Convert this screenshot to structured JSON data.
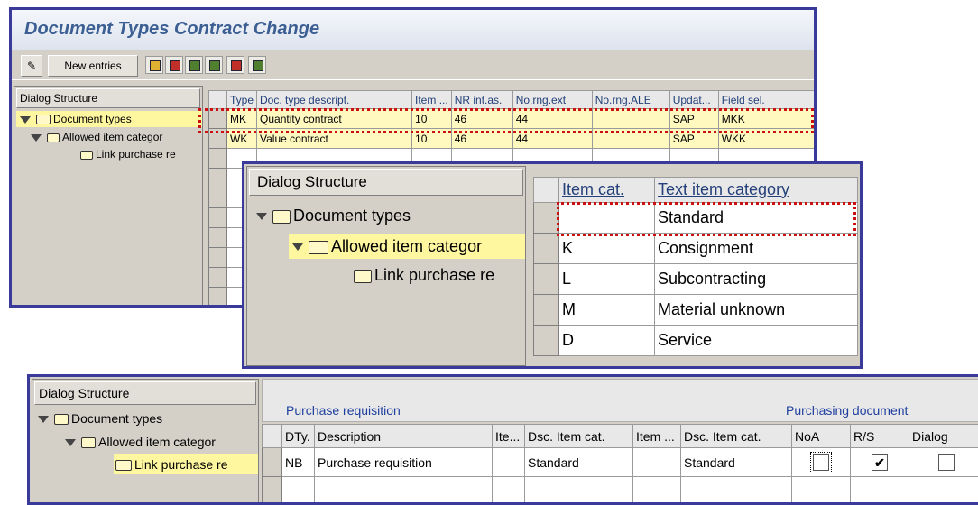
{
  "window1": {
    "title": "Document Types Contract Change",
    "toolbar": {
      "new_entries_label": "New entries"
    },
    "dialog": {
      "header": "Dialog Structure",
      "items": [
        "Document types",
        "Allowed item categor",
        "Link purchase re"
      ]
    },
    "table": {
      "columns": [
        "Type",
        "Doc. type descript.",
        "Item ...",
        "NR int.as.",
        "No.rng.ext",
        "No.rng.ALE",
        "Updat...",
        "Field sel."
      ],
      "rows": [
        [
          "MK",
          "Quantity contract",
          "10",
          "46",
          "44",
          "",
          "SAP",
          "MKK"
        ],
        [
          "WK",
          "Value contract",
          "10",
          "46",
          "44",
          "",
          "SAP",
          "WKK"
        ]
      ]
    }
  },
  "window2": {
    "dialog": {
      "header": "Dialog Structure",
      "items": [
        "Document types",
        "Allowed item categor",
        "Link purchase re"
      ]
    },
    "table": {
      "columns": [
        "Item cat.",
        "Text item category"
      ],
      "rows": [
        [
          "",
          "Standard"
        ],
        [
          "K",
          "Consignment"
        ],
        [
          "L",
          "Subcontracting"
        ],
        [
          "M",
          "Material unknown"
        ],
        [
          "D",
          "Service"
        ]
      ]
    }
  },
  "window3": {
    "dialog": {
      "header": "Dialog Structure",
      "items": [
        "Document types",
        "Allowed item categor",
        "Link purchase re"
      ]
    },
    "group_left": "Purchase requisition",
    "group_right": "Purchasing document",
    "table": {
      "columns": [
        "DTy.",
        "Description",
        "Ite...",
        "Dsc. Item cat.",
        "Item ...",
        "Dsc. Item cat.",
        "NoA",
        "R/S",
        "Dialog"
      ],
      "row": {
        "dty": "NB",
        "description": "Purchase requisition",
        "ite": "",
        "dsc_item_cat": "Standard",
        "item": "",
        "dsc_item_cat2": "Standard",
        "noa_checked": false,
        "rs_checked": true,
        "dialog_checked": false
      },
      "check_mark": "✔"
    }
  }
}
